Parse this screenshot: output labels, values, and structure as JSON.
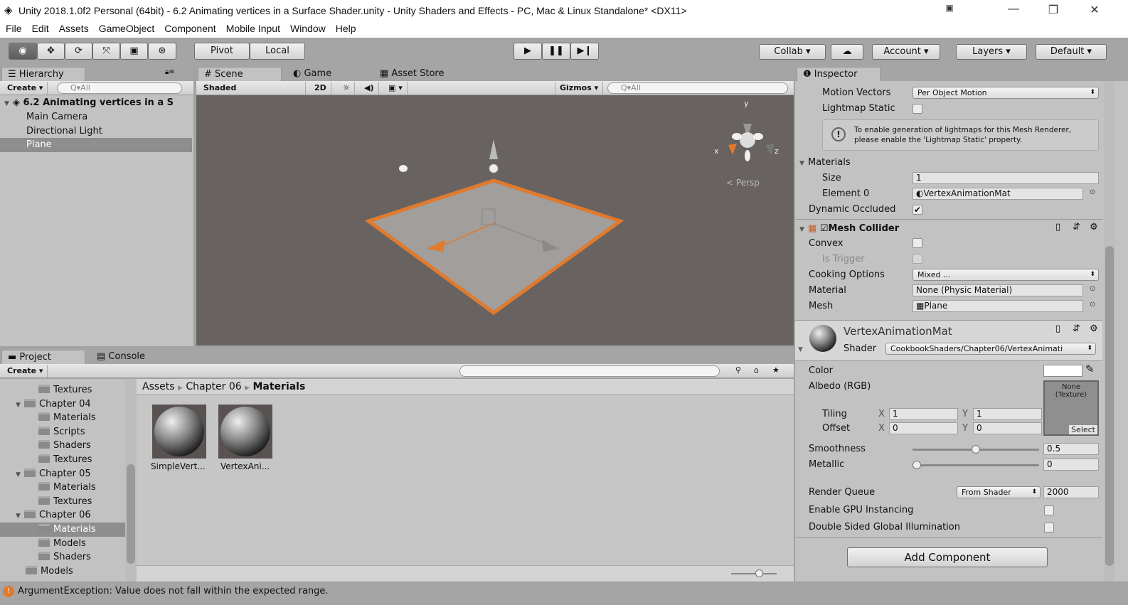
{
  "window": {
    "title": "Unity 2018.1.0f2 Personal (64bit) - 6.2 Animating vertices in a Surface Shader.unity - Unity Shaders and Effects - PC, Mac & Linux Standalone* <DX11>"
  },
  "menu": [
    "File",
    "Edit",
    "Assets",
    "GameObject",
    "Component",
    "Mobile Input",
    "Window",
    "Help"
  ],
  "toolbar": {
    "pivot": "Pivot",
    "local": "Local",
    "collab": "Collab ▾",
    "account": "Account",
    "layers": "Layers",
    "layout": "Default"
  },
  "hierarchy": {
    "tab": "Hierarchy",
    "create": "Create ▾",
    "search": "Q▾All",
    "scene": "6.2 Animating vertices in a S",
    "items": [
      "Main Camera",
      "Directional Light",
      "Plane"
    ]
  },
  "scene": {
    "tabs": [
      "Scene",
      "Game",
      "Asset Store"
    ],
    "shading": "Shaded",
    "mode2d": "2D",
    "gizmos": "Gizmos ▾",
    "search": "Q▾All",
    "persp": "< Persp",
    "axes": {
      "x": "x",
      "y": "y",
      "z": "z"
    }
  },
  "inspector": {
    "tab": "Inspector",
    "motion_vectors": {
      "label": "Motion Vectors",
      "value": "Per Object Motion"
    },
    "lightmap_static": {
      "label": "Lightmap Static",
      "checked": false
    },
    "info": "To enable generation of lightmaps for this Mesh Renderer, please enable the 'Lightmap Static' property.",
    "materials": {
      "label": "Materials",
      "size_label": "Size",
      "size": "1",
      "element0_label": "Element 0",
      "element0": "VertexAnimationMat"
    },
    "dynamic_occluded": {
      "label": "Dynamic Occluded",
      "checked": true
    },
    "mesh_collider": {
      "title": "Mesh Collider",
      "convex": "Convex",
      "is_trigger": "Is Trigger",
      "cooking_label": "Cooking Options",
      "cooking": "Mixed ...",
      "material_label": "Material",
      "material": "None (Physic Material)",
      "mesh_label": "Mesh",
      "mesh": "Plane"
    },
    "material": {
      "name": "VertexAnimationMat",
      "shader_label": "Shader",
      "shader": "CookbookShaders/Chapter06/VertexAnimati",
      "color": "Color",
      "albedo": "Albedo (RGB)",
      "texture": "None (Texture)",
      "select": "Select",
      "tiling": "Tiling",
      "offset": "Offset",
      "x": "X",
      "y": "Y",
      "tiling_x": "1",
      "tiling_y": "1",
      "offset_x": "0",
      "offset_y": "0",
      "smoothness": "Smoothness",
      "smoothness_value": "0.5",
      "metallic": "Metallic",
      "metallic_value": "0",
      "render_queue": "Render Queue",
      "render_queue_mode": "From Shader",
      "render_queue_value": "2000",
      "gpu_instancing": "Enable GPU Instancing",
      "double_sided": "Double Sided Global Illumination"
    },
    "add_component": "Add Component"
  },
  "project": {
    "tabs": [
      "Project",
      "Console"
    ],
    "create": "Create ▾",
    "tree": [
      {
        "label": "Textures",
        "indent": 2
      },
      {
        "label": "Chapter 04",
        "indent": 1,
        "open": true
      },
      {
        "label": "Materials",
        "indent": 2
      },
      {
        "label": "Scripts",
        "indent": 2
      },
      {
        "label": "Shaders",
        "indent": 2
      },
      {
        "label": "Textures",
        "indent": 2
      },
      {
        "label": "Chapter 05",
        "indent": 1,
        "open": true
      },
      {
        "label": "Materials",
        "indent": 2
      },
      {
        "label": "Textures",
        "indent": 2
      },
      {
        "label": "Chapter 06",
        "indent": 1,
        "open": true
      },
      {
        "label": "Materials",
        "indent": 2,
        "selected": true
      },
      {
        "label": "Models",
        "indent": 2
      },
      {
        "label": "Shaders",
        "indent": 2
      },
      {
        "label": "Models",
        "indent": 1
      }
    ],
    "breadcrumb": [
      "Assets",
      "Chapter 06",
      "Materials"
    ],
    "assets": [
      "SimpleVert...",
      "VertexAni..."
    ]
  },
  "status": {
    "message": "ArgumentException: Value does not fall within the expected range."
  },
  "colors": {
    "selection_orange": "#e07a2e",
    "scene_bg": "#686361",
    "panel": "#c2c2c2"
  }
}
